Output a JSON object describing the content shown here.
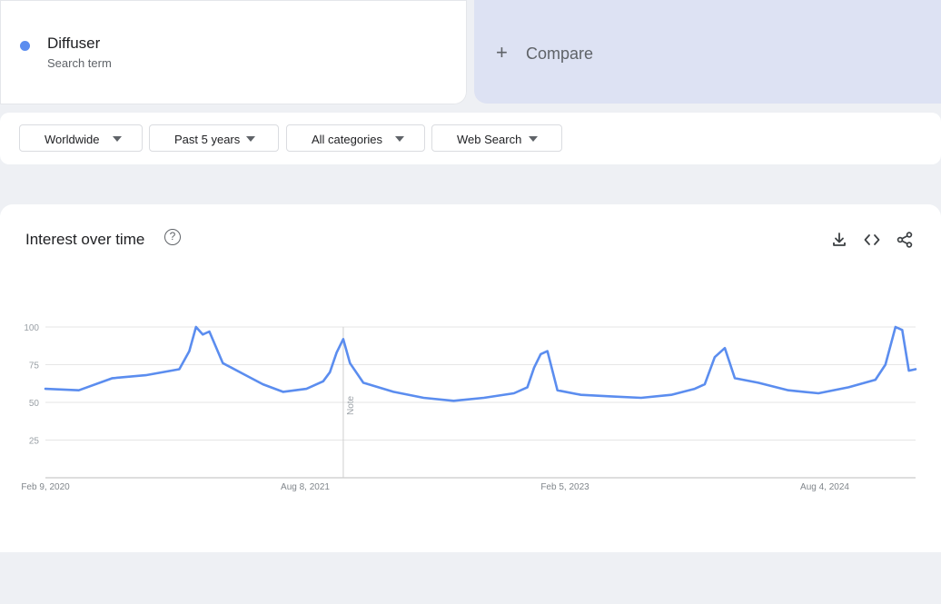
{
  "search_term": {
    "name": "Diffuser",
    "subtitle": "Search term",
    "color": "#5b8def"
  },
  "compare": {
    "label": "Compare",
    "icon": "plus-icon"
  },
  "filters": [
    {
      "label": "Worldwide",
      "icon": "dropdown-caret-icon"
    },
    {
      "label": "Past 5 years",
      "icon": "dropdown-caret-icon"
    },
    {
      "label": "All categories",
      "icon": "dropdown-caret-icon"
    },
    {
      "label": "Web Search",
      "icon": "dropdown-caret-icon"
    }
  ],
  "chart_card": {
    "title": "Interest over time",
    "icons": [
      "help-icon",
      "download-icon",
      "embed-code-icon",
      "share-icon"
    ]
  },
  "chart_data": {
    "type": "line",
    "title": "Interest over time",
    "xlabel": "",
    "ylabel": "",
    "ylim": [
      0,
      100
    ],
    "yticks": [
      25,
      50,
      75,
      100
    ],
    "xtick_labels": [
      "Feb 9, 2020",
      "Aug 8, 2021",
      "Feb 5, 2023",
      "Aug 4, 2024"
    ],
    "x_range": [
      "2020-02-09",
      "2025-02-02"
    ],
    "annotation": {
      "label": "Note",
      "date": "2021-10-24"
    },
    "grid": true,
    "legend": "none",
    "series": [
      {
        "color": "#5b8def",
        "x": [
          "2020-02-09",
          "2020-04-19",
          "2020-06-28",
          "2020-09-06",
          "2020-11-15",
          "2020-12-06",
          "2020-12-20",
          "2021-01-03",
          "2021-01-17",
          "2021-02-14",
          "2021-03-28",
          "2021-05-09",
          "2021-06-20",
          "2021-08-08",
          "2021-09-12",
          "2021-09-26",
          "2021-10-10",
          "2021-10-24",
          "2021-11-07",
          "2021-12-05",
          "2022-02-06",
          "2022-04-10",
          "2022-06-12",
          "2022-08-14",
          "2022-10-16",
          "2022-11-13",
          "2022-11-27",
          "2022-12-11",
          "2022-12-25",
          "2023-01-15",
          "2023-03-05",
          "2023-05-07",
          "2023-07-09",
          "2023-09-10",
          "2023-10-29",
          "2023-11-19",
          "2023-12-10",
          "2023-12-31",
          "2024-01-21",
          "2024-03-10",
          "2024-05-12",
          "2024-07-14",
          "2024-09-15",
          "2024-11-10",
          "2024-12-01",
          "2024-12-22",
          "2025-01-05",
          "2025-01-19",
          "2025-02-02"
        ],
        "values": [
          59,
          58,
          66,
          68,
          72,
          84,
          100,
          95,
          97,
          76,
          69,
          62,
          57,
          59,
          64,
          70,
          83,
          92,
          76,
          63,
          57,
          53,
          51,
          53,
          56,
          60,
          73,
          82,
          84,
          58,
          55,
          54,
          53,
          55,
          59,
          62,
          80,
          86,
          66,
          63,
          58,
          56,
          60,
          65,
          75,
          100,
          98,
          71,
          72
        ]
      }
    ]
  }
}
